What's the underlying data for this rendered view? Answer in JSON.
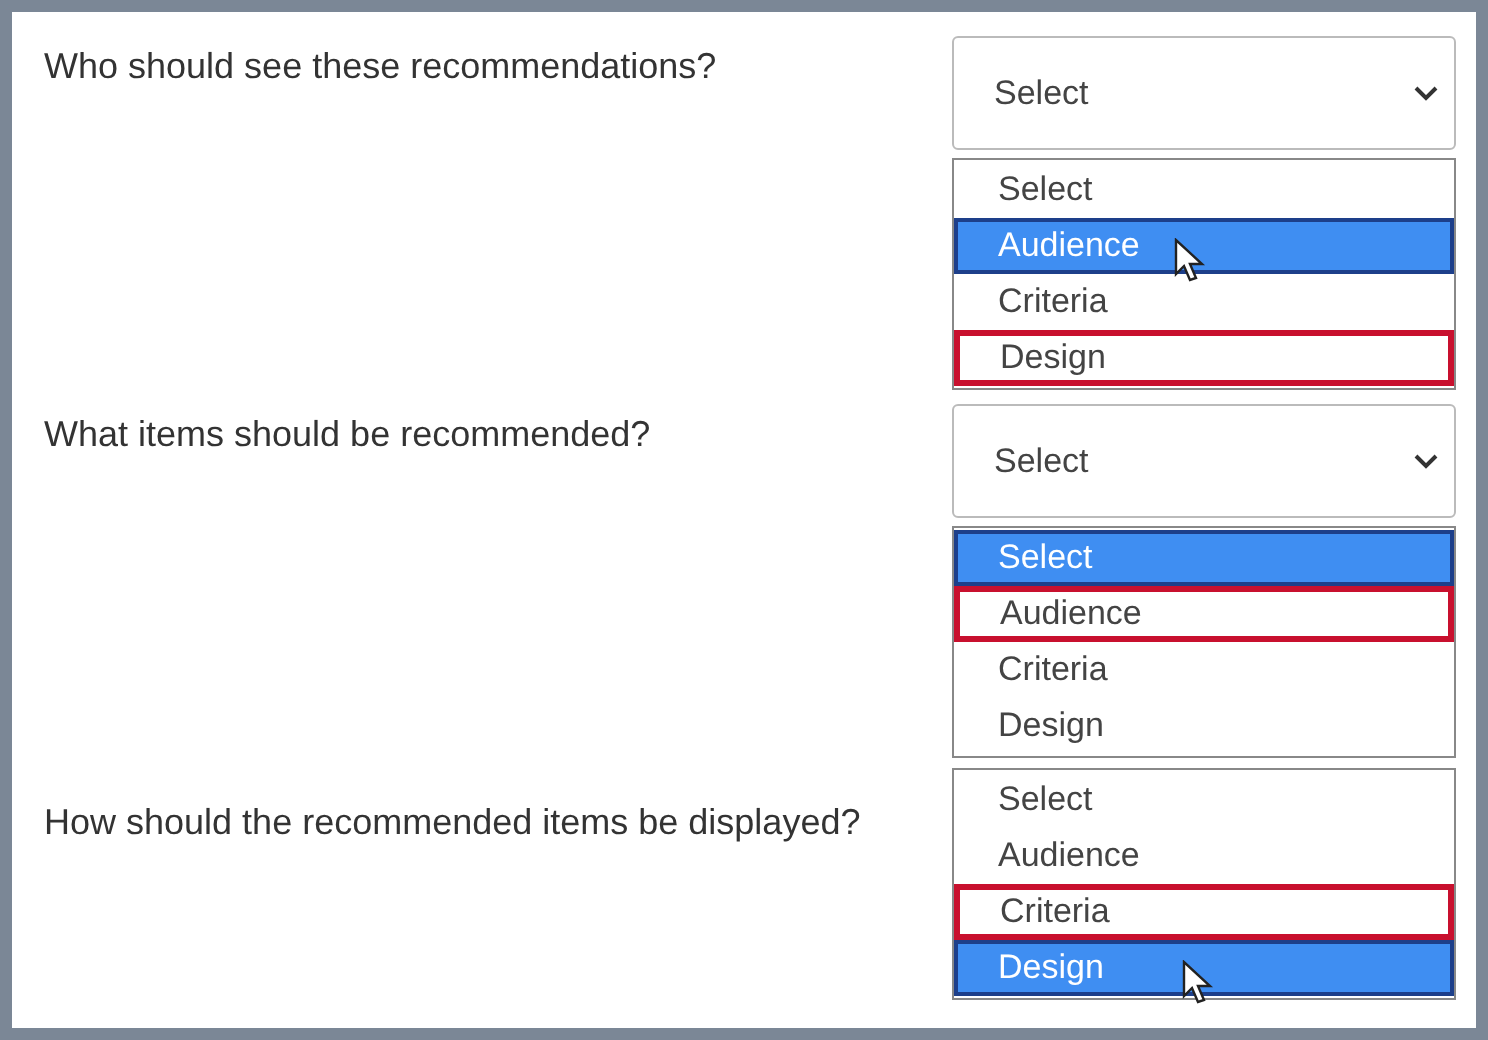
{
  "questions": [
    {
      "text": "Who should see these recommendations?",
      "select": {
        "value": "Select"
      },
      "options": [
        {
          "label": "Select",
          "highlighted": false,
          "answer": false,
          "cursor": false
        },
        {
          "label": "Audience",
          "highlighted": true,
          "answer": false,
          "cursor": true
        },
        {
          "label": "Criteria",
          "highlighted": false,
          "answer": false,
          "cursor": false
        },
        {
          "label": "Design",
          "highlighted": false,
          "answer": true,
          "cursor": false
        }
      ]
    },
    {
      "text": "What items should be recommended?",
      "select": {
        "value": "Select"
      },
      "options": [
        {
          "label": "Select",
          "highlighted": true,
          "answer": false,
          "cursor": false
        },
        {
          "label": "Audience",
          "highlighted": false,
          "answer": true,
          "cursor": false
        },
        {
          "label": "Criteria",
          "highlighted": false,
          "answer": false,
          "cursor": false
        },
        {
          "label": "Design",
          "highlighted": false,
          "answer": false,
          "cursor": false
        }
      ]
    },
    {
      "text": "How should the recommended items be displayed?",
      "options": [
        {
          "label": "Select",
          "highlighted": false,
          "answer": false,
          "cursor": false
        },
        {
          "label": "Audience",
          "highlighted": false,
          "answer": false,
          "cursor": false
        },
        {
          "label": "Criteria",
          "highlighted": false,
          "answer": true,
          "cursor": false
        },
        {
          "label": "Design",
          "highlighted": true,
          "answer": false,
          "cursor": true
        }
      ]
    }
  ]
}
